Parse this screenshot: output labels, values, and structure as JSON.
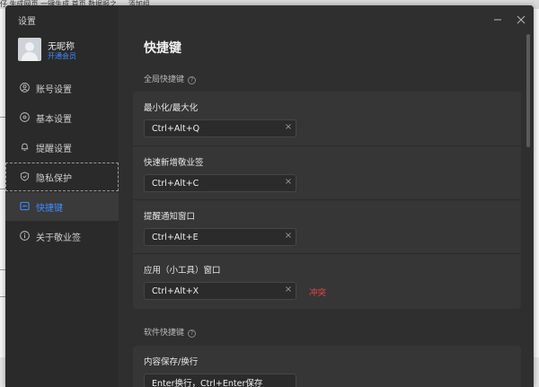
{
  "background": {
    "top_text": "仔 生成网页 一键生成 首页 数据报之 ... 添加组"
  },
  "dialog": {
    "title": "设置",
    "user": {
      "name": "无昵称",
      "vip_link": "开通会员"
    },
    "nav": [
      {
        "label": "账号设置",
        "icon": "user-icon"
      },
      {
        "label": "基本设置",
        "icon": "settings-icon"
      },
      {
        "label": "提醒设置",
        "icon": "bell-icon"
      },
      {
        "label": "隐私保护",
        "icon": "shield-icon"
      },
      {
        "label": "快捷键",
        "icon": "keyboard-icon",
        "active": true
      },
      {
        "label": "关于敬业签",
        "icon": "info-icon"
      }
    ],
    "page_title": "快捷键",
    "global_section": {
      "label": "全局快捷键",
      "rows": [
        {
          "label": "最小化/最大化",
          "value": "Ctrl+Alt+Q"
        },
        {
          "label": "快速新增敬业签",
          "value": "Ctrl+Alt+C"
        },
        {
          "label": "提醒通知窗口",
          "value": "Ctrl+Alt+E"
        },
        {
          "label": "应用（小工具）窗口",
          "value": "Ctrl+Alt+X",
          "status": "冲突"
        }
      ]
    },
    "software_section": {
      "label": "软件快捷键",
      "rows": [
        {
          "label": "内容保存/换行",
          "value": "Enter换行，Ctrl+Enter保存"
        }
      ]
    },
    "colors": {
      "accent": "#3f8cff",
      "conflict": "#e64545",
      "panel_bg": "#2f2f2f",
      "sidebar_bg": "#2a2a2a"
    }
  }
}
